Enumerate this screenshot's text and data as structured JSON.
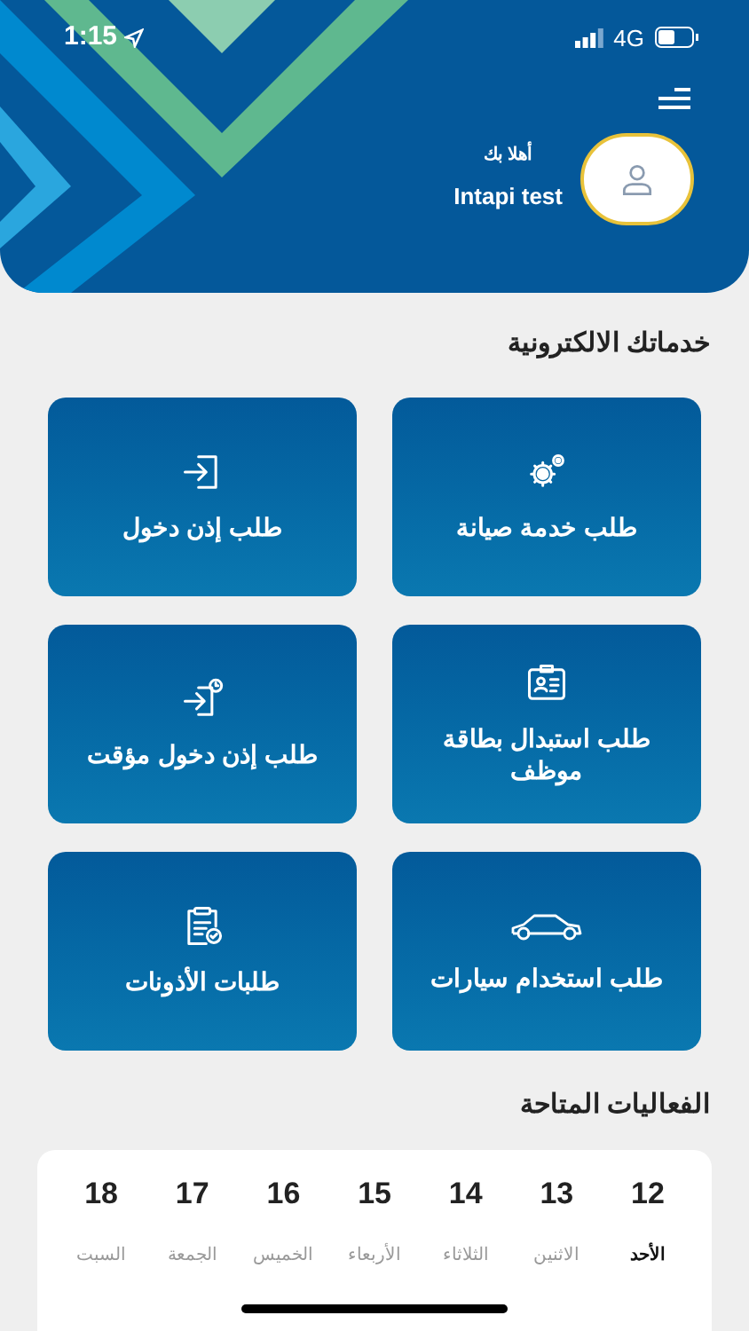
{
  "status_bar": {
    "time": "1:15",
    "network": "4G"
  },
  "header": {
    "greeting": "أهلا بك",
    "user_name": "Intapi test"
  },
  "services": {
    "title": "خدماتك الالكترونية",
    "items": [
      {
        "kind": "maintenance",
        "label": "طلب خدمة صيانة"
      },
      {
        "kind": "entry",
        "label": "طلب إذن دخول"
      },
      {
        "kind": "badge",
        "label": "طلب استبدال بطاقة موظف"
      },
      {
        "kind": "temp_entry",
        "label": "طلب إذن دخول مؤقت"
      },
      {
        "kind": "car",
        "label": "طلب استخدام سيارات"
      },
      {
        "kind": "requests",
        "label": "طلبات الأذونات"
      }
    ]
  },
  "events": {
    "title": "الفعاليات المتاحة",
    "days": [
      {
        "date": "12",
        "weekday": "الأحد",
        "selected": true
      },
      {
        "date": "13",
        "weekday": "الاثنين",
        "selected": false
      },
      {
        "date": "14",
        "weekday": "الثلاثاء",
        "selected": false
      },
      {
        "date": "15",
        "weekday": "الأربعاء",
        "selected": false
      },
      {
        "date": "16",
        "weekday": "الخميس",
        "selected": false
      },
      {
        "date": "17",
        "weekday": "الجمعة",
        "selected": false
      },
      {
        "date": "18",
        "weekday": "السبت",
        "selected": false
      }
    ]
  }
}
